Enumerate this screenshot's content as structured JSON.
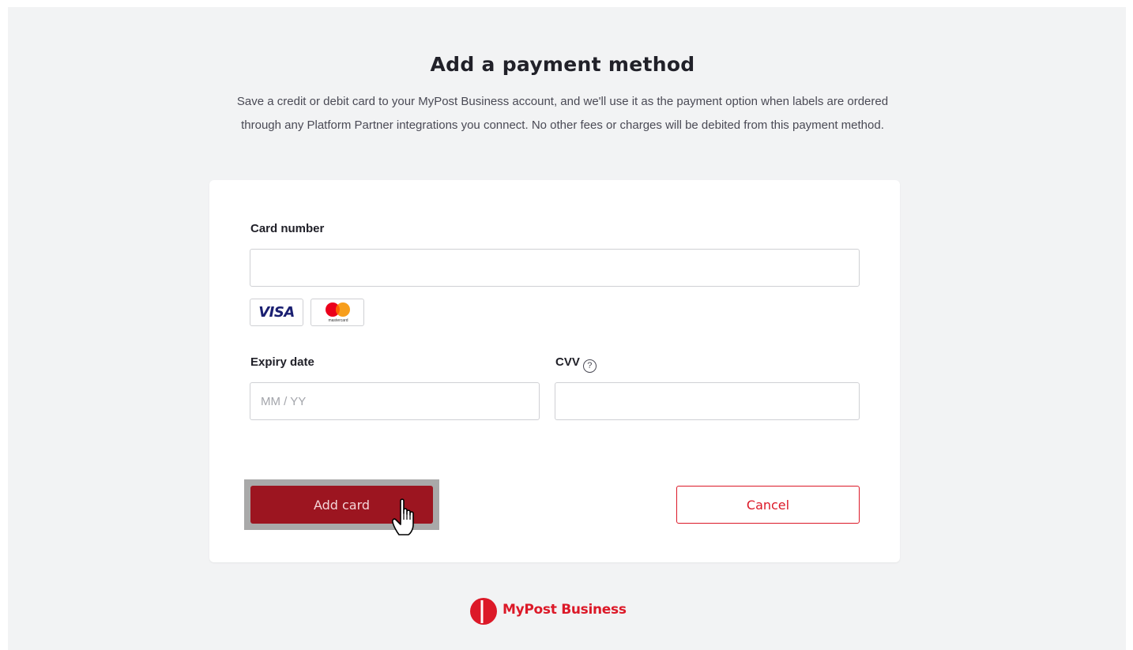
{
  "header": {
    "title": "Add a payment method",
    "description": "Save a credit or debit card to your MyPost Business account, and we'll use it as the payment option when labels are ordered through any Platform Partner integrations you connect. No other fees or charges will be debited from this payment method."
  },
  "form": {
    "card_number": {
      "label": "Card number",
      "value": "",
      "placeholder": ""
    },
    "accepted_cards": [
      {
        "name": "VISA",
        "icon": "visa-logo"
      },
      {
        "name": "mastercard",
        "icon": "mastercard-logo"
      }
    ],
    "expiry": {
      "label": "Expiry date",
      "value": "",
      "placeholder": "MM / YY"
    },
    "cvv": {
      "label": "CVV",
      "value": "",
      "placeholder": "",
      "help_icon": "question-circle-icon"
    },
    "add_button_label": "Add card",
    "cancel_button_label": "Cancel"
  },
  "footer": {
    "brand": "MyPost Business",
    "logo_icon": "australia-post-logo"
  },
  "colors": {
    "background": "#f2f3f4",
    "primary_button": "#9c1520",
    "accent_red": "#dc1928",
    "title_text": "#212129"
  }
}
